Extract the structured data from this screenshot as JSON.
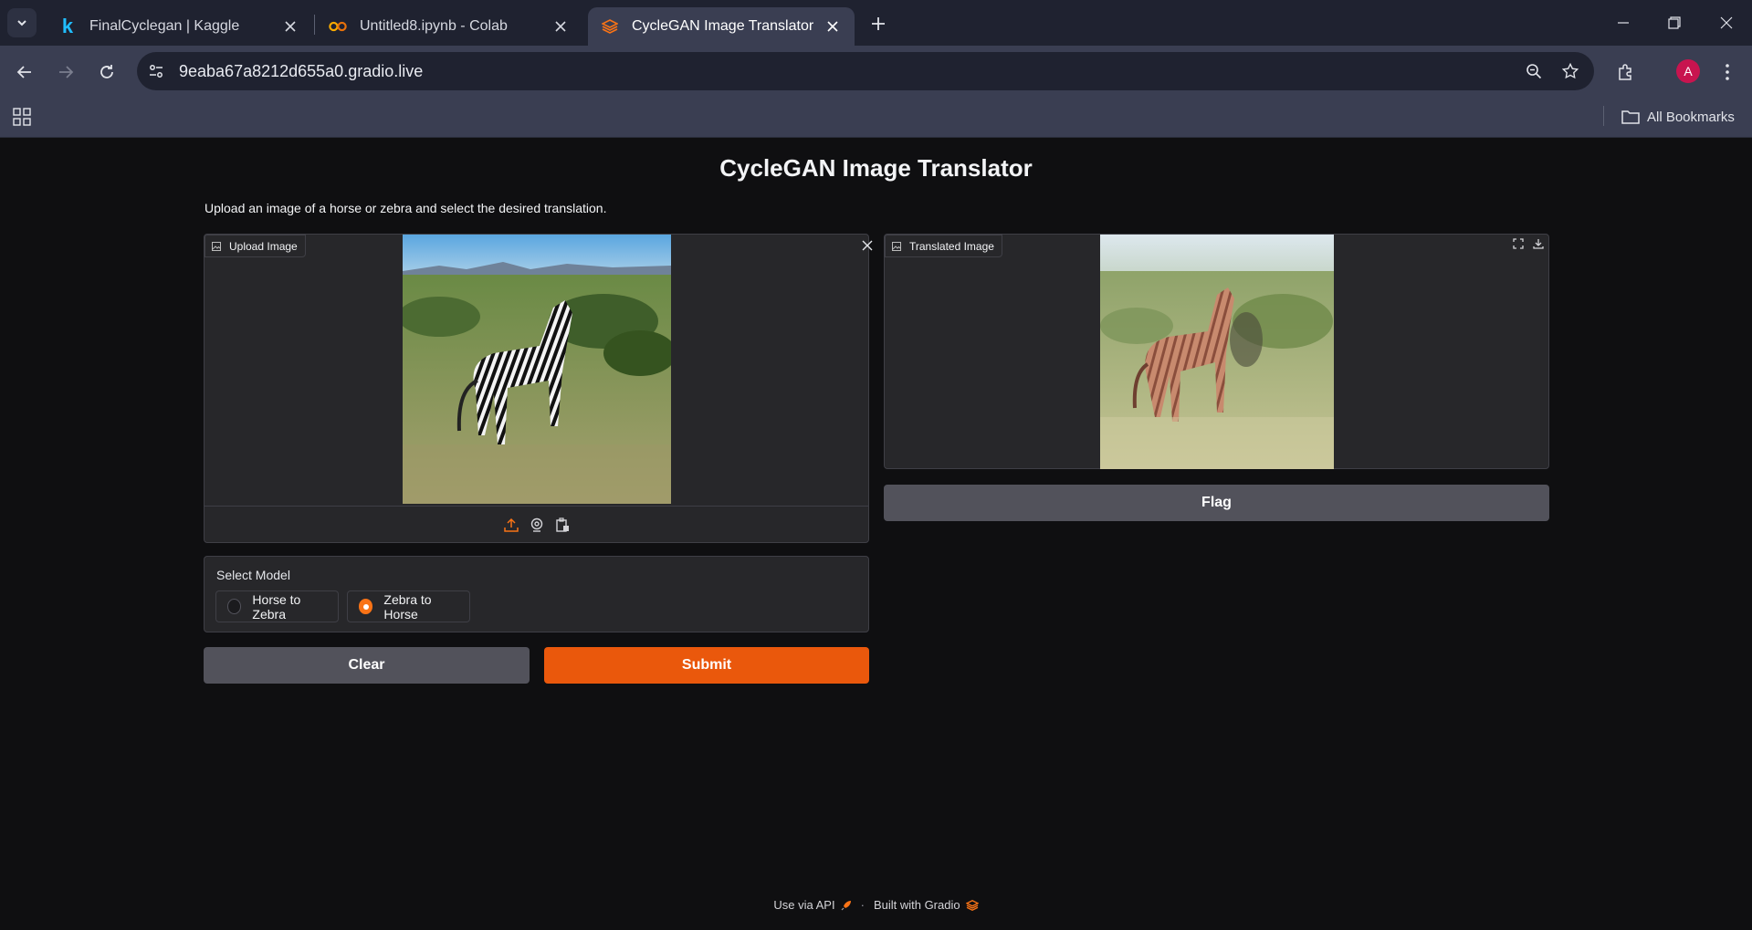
{
  "browser": {
    "tabs": [
      {
        "title": "FinalCyclegan | Kaggle",
        "favicon": "kaggle-k-icon",
        "active": false
      },
      {
        "title": "Untitled8.ipynb - Colab",
        "favicon": "colab-icon",
        "active": false
      },
      {
        "title": "CycleGAN Image Translator",
        "favicon": "gradio-icon",
        "active": true
      }
    ],
    "url": "9eaba67a8212d655a0.gradio.live",
    "profile_initial": "A",
    "bookmarks_label": "All Bookmarks",
    "colors": {
      "tabbar": "#1f2230",
      "toolbar": "#3a3e52",
      "avatar": "#c8144f"
    }
  },
  "app": {
    "title": "CycleGAN Image Translator",
    "description": "Upload an image of a horse or zebra and select the desired translation.",
    "input_image": {
      "label": "Upload Image"
    },
    "output_image": {
      "label": "Translated Image"
    },
    "model_select": {
      "label": "Select Model",
      "options": [
        "Horse to Zebra",
        "Zebra to Horse"
      ],
      "selected": "Zebra to Horse"
    },
    "buttons": {
      "clear": "Clear",
      "submit": "Submit",
      "flag": "Flag"
    },
    "footer": {
      "api": "Use via API",
      "separator": "·",
      "built": "Built with Gradio"
    },
    "colors": {
      "accent": "#ea580c",
      "panel": "#27272a",
      "border": "#3f3f46",
      "background": "#0f0f11"
    }
  }
}
